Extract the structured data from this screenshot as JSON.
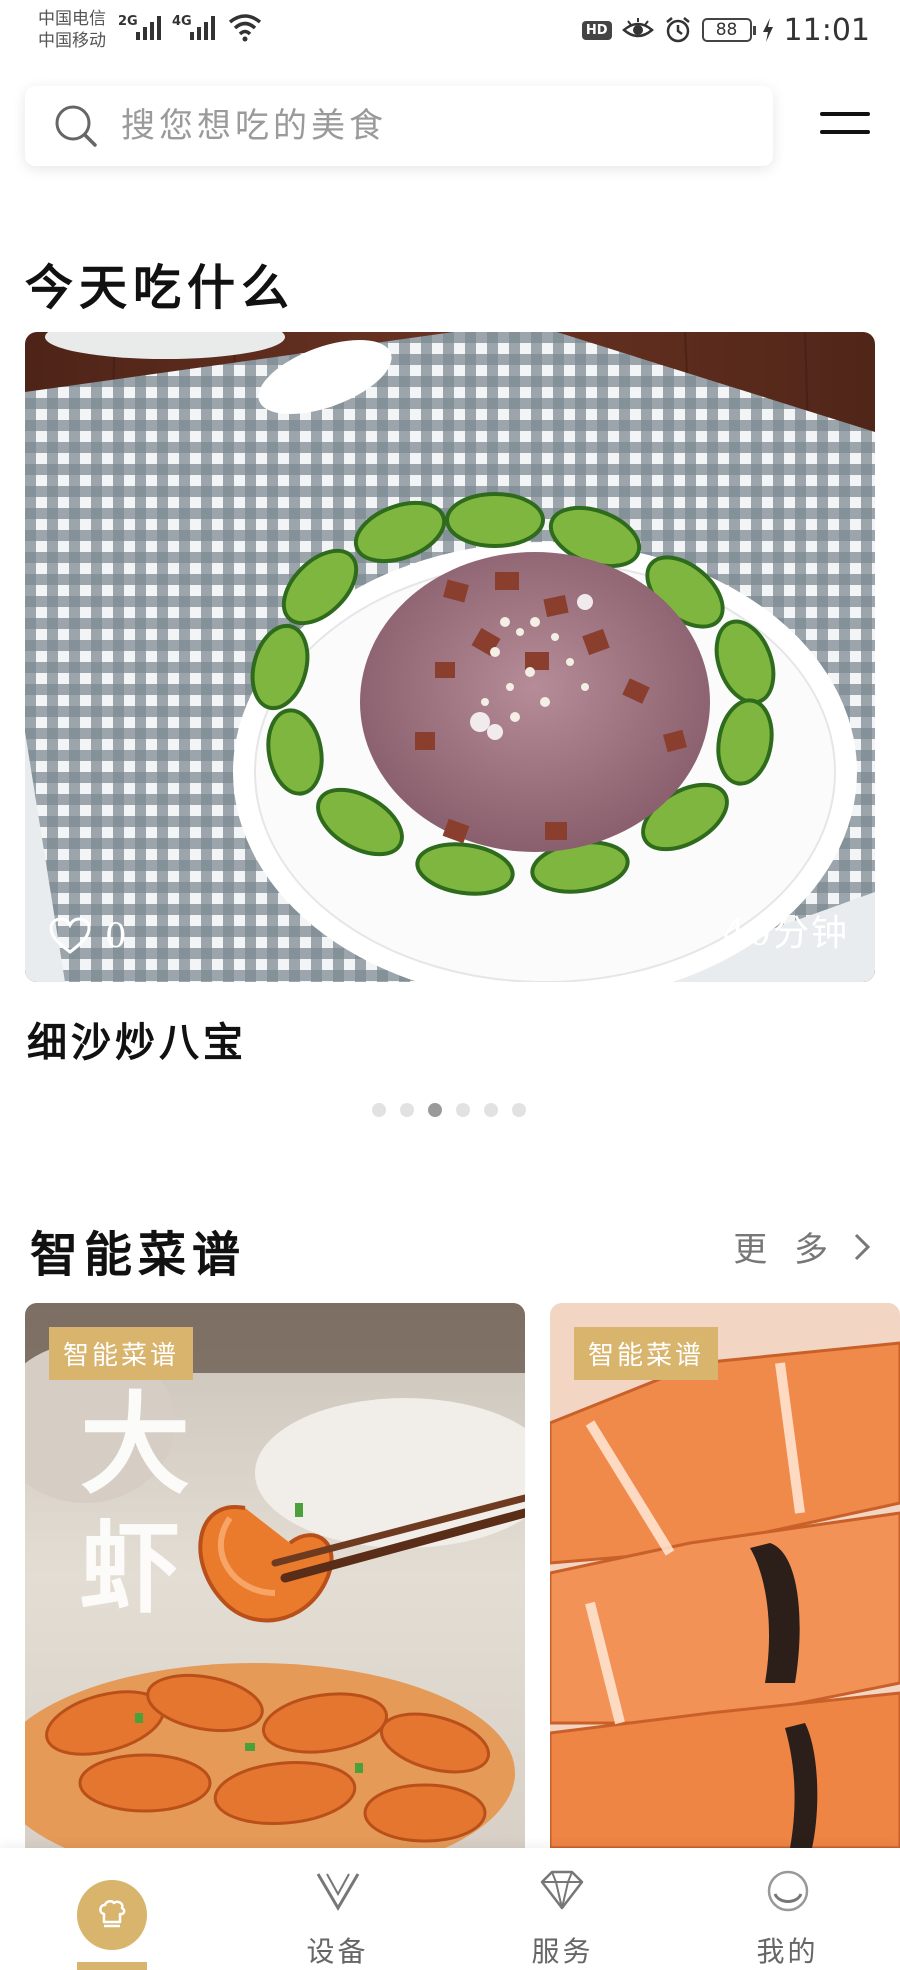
{
  "status_bar": {
    "carrier_1": "中国电信",
    "carrier_2": "中国移动",
    "signal_1": "2G",
    "signal_2": "4G",
    "hd": "HD",
    "battery": "88",
    "time": "11:01"
  },
  "search": {
    "placeholder": "搜您想吃的美食",
    "icon": "search-icon"
  },
  "today": {
    "title": "今天吃什么",
    "likes": "0",
    "time": "40分钟",
    "dish_name": "细沙炒八宝",
    "carousel_count": 6,
    "carousel_active_index": 2
  },
  "smart_recipes": {
    "title": "智能菜谱",
    "more_label": "更 多",
    "cards": [
      {
        "tag": "智能菜谱"
      },
      {
        "tag": "智能菜谱"
      }
    ]
  },
  "nav": {
    "items": [
      {
        "label": "",
        "icon": "chef-hat-icon",
        "active": true
      },
      {
        "label": "设备",
        "icon": "v-device-icon"
      },
      {
        "label": "服务",
        "icon": "diamond-icon"
      },
      {
        "label": "我的",
        "icon": "profile-circle-icon"
      }
    ]
  },
  "colors": {
    "accent": "#d8b46d",
    "text": "#111111",
    "muted": "#9a9a9a"
  }
}
